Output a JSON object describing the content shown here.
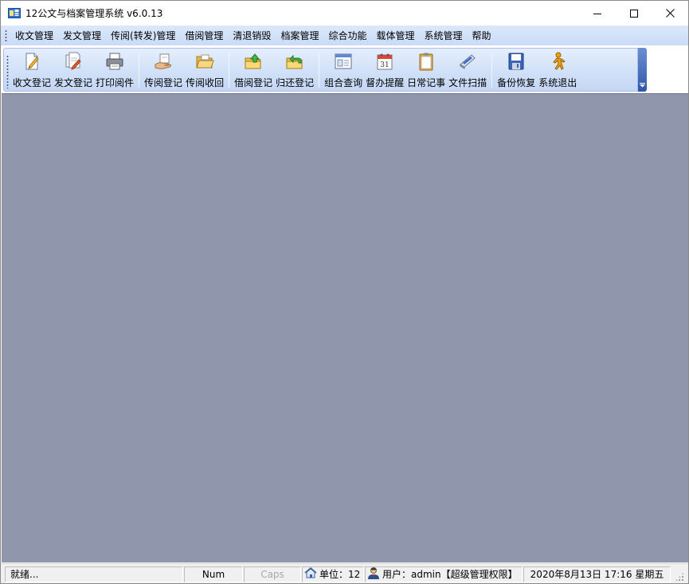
{
  "window": {
    "title": "12公文与档案管理系统 v6.0.13",
    "controls": {
      "minimize": "minimize-icon",
      "maximize": "maximize-icon",
      "close": "close-icon"
    }
  },
  "menubar": {
    "items": [
      "收文管理",
      "发文管理",
      "传阅(转发)管理",
      "借阅管理",
      "清退销毁",
      "档案管理",
      "综合功能",
      "载体管理",
      "系统管理",
      "帮助"
    ]
  },
  "toolbar": {
    "groups": [
      [
        {
          "label": "收文登记",
          "icon": "pencil-document-icon"
        },
        {
          "label": "发文登记",
          "icon": "edit-documents-icon"
        },
        {
          "label": "打印阅件",
          "icon": "printer-icon"
        }
      ],
      [
        {
          "label": "传阅登记",
          "icon": "hand-document-icon"
        },
        {
          "label": "传阅收回",
          "icon": "open-folder-icon"
        }
      ],
      [
        {
          "label": "借阅登记",
          "icon": "folder-out-icon"
        },
        {
          "label": "归还登记",
          "icon": "folder-return-icon"
        }
      ],
      [
        {
          "label": "组合查询",
          "icon": "window-search-icon"
        },
        {
          "label": "督办提醒",
          "icon": "calendar-icon"
        },
        {
          "label": "日常记事",
          "icon": "clipboard-icon"
        },
        {
          "label": "文件扫描",
          "icon": "scanner-icon"
        }
      ],
      [
        {
          "label": "备份恢复",
          "icon": "floppy-disk-icon"
        },
        {
          "label": "系统退出",
          "icon": "running-man-icon"
        }
      ]
    ]
  },
  "statusbar": {
    "ready": "就绪...",
    "num": "Num",
    "caps": "Caps",
    "unit": "单位：12",
    "user": "用户：admin【超级管理权限】",
    "datetime": "2020年8月13日 17:16 星期五"
  },
  "colors": {
    "client_bg": "#9096ab",
    "menubar_bg": "#d3e2f8",
    "toolbar_bg": "#d2e1f8"
  }
}
